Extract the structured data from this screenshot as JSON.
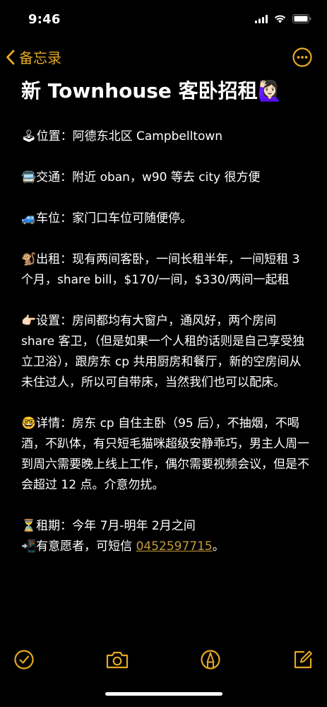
{
  "status": {
    "time": "9:46"
  },
  "nav": {
    "back_label": "备忘录"
  },
  "note": {
    "title": "新 Townhouse 客卧招租🙋🏻‍♀️",
    "p1": "🕹位置：阿德东北区 Campbelltown",
    "p2": "🚍交通：附近 oban，w90 等去 city 很方便",
    "p3": "🚙车位：家门口车位可随便停。",
    "p4": "🐒出租：现有两间客卧，一间长租半年，一间短租 3 个月，share bill，$170/一间，$330/两间一起租",
    "p5": "👉🏻设置：房间都均有大窗户，通风好，两个房间 share 客卫，（但是如果一个人租的话则是自己享受独立卫浴），跟房东 cp 共用厨房和餐厅，新的空房间从未住过人，所以可自带床，当然我们也可以配床。",
    "p6": "🤓详情：房东 cp 自住主卧（95 后），不抽烟，不喝酒，不趴体，有只短毛猫咪超级安静乖巧，男主人周一到周六需要晚上线上工作，偶尔需要视频会议，但是不会超过 12 点。介意勿扰。",
    "p7": "⏳租期：今年 7月-明年 2月之间",
    "p8_prefix": "📲有意愿者，可短信 ",
    "phone": "0452597715",
    "p8_suffix": "。"
  },
  "colors": {
    "accent": "#e5a823",
    "background": "#000000",
    "text": "#ffffff"
  },
  "icons": [
    "signal-icon",
    "wifi-icon",
    "battery-icon",
    "chevron-left-icon",
    "more-icon",
    "checklist-icon",
    "camera-icon",
    "markup-icon",
    "compose-icon"
  ]
}
